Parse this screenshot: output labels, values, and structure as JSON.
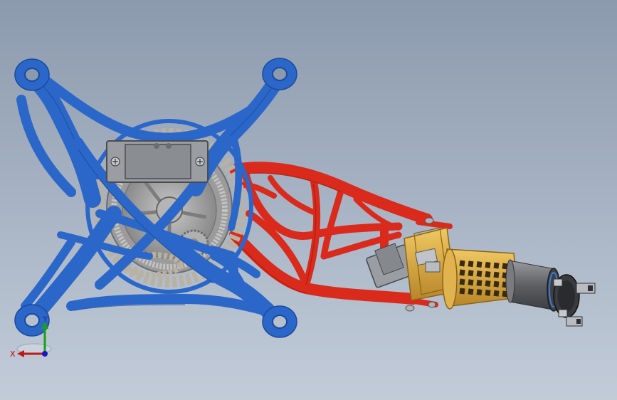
{
  "viewport": {
    "background_top": "#8c9aae",
    "background_bottom": "#c2ccd9"
  },
  "model": {
    "frame_color": "#2b67c9",
    "frame_dark": "#1b4a9b",
    "arm_color": "#d92a1c",
    "arm_dark": "#9e180f",
    "gear_color": "#a9a9a9",
    "servo_color": "#8f9296",
    "gearbox_color": "#d7a73c",
    "motor_color": "#6e6f72"
  },
  "triad": {
    "x_label": "X",
    "y_label": "Y",
    "x_color": "#c01818",
    "y_color": "#18a018",
    "z_color": "#1818c0",
    "x_icon": "x-axis-arrow-icon",
    "y_icon": "y-axis-arrow-icon"
  }
}
